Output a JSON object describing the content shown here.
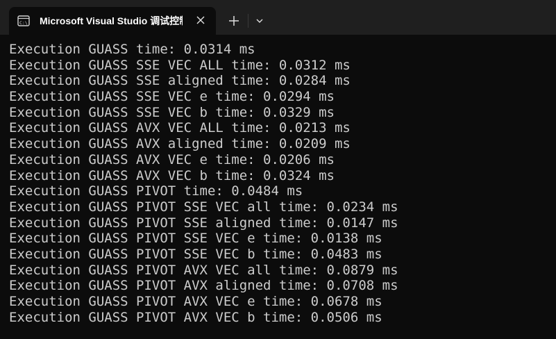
{
  "tab": {
    "title": "Microsoft Visual Studio 调试控制台",
    "icon": "terminal-icon"
  },
  "toolbar": {
    "new_tab_icon": "plus-icon",
    "dropdown_icon": "chevron-down-icon",
    "close_icon": "close-icon"
  },
  "colors": {
    "background": "#0c0c0c",
    "titlebar": "#1f1f1f",
    "text": "#cccccc"
  },
  "output": {
    "lines": [
      "Execution GUASS time: 0.0314 ms",
      "Execution GUASS SSE VEC ALL time: 0.0312 ms",
      "Execution GUASS SSE aligned time: 0.0284 ms",
      "Execution GUASS SSE VEC e time: 0.0294 ms",
      "Execution GUASS SSE VEC b time: 0.0329 ms",
      "Execution GUASS AVX VEC ALL time: 0.0213 ms",
      "Execution GUASS AVX aligned time: 0.0209 ms",
      "Execution GUASS AVX VEC e time: 0.0206 ms",
      "Execution GUASS AVX VEC b time: 0.0324 ms",
      "Execution GUASS PIVOT time: 0.0484 ms",
      "Execution GUASS PIVOT SSE VEC all time: 0.0234 ms",
      "Execution GUASS PIVOT SSE aligned time: 0.0147 ms",
      "Execution GUASS PIVOT SSE VEC e time: 0.0138 ms",
      "Execution GUASS PIVOT SSE VEC b time: 0.0483 ms",
      "Execution GUASS PIVOT AVX VEC all time: 0.0879 ms",
      "Execution GUASS PIVOT AVX aligned time: 0.0708 ms",
      "Execution GUASS PIVOT AVX VEC e time: 0.0678 ms",
      "Execution GUASS PIVOT AVX VEC b time: 0.0506 ms"
    ]
  }
}
